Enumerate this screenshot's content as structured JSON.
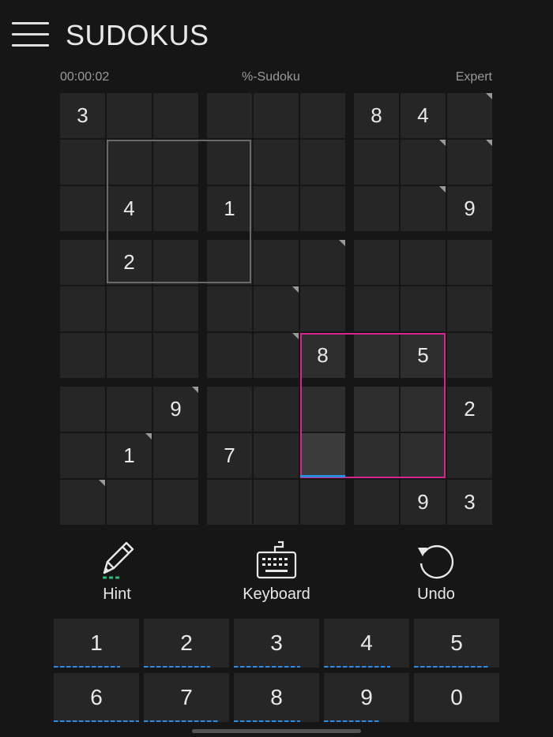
{
  "app": {
    "title": "SUDOKUS"
  },
  "status": {
    "timer": "00:00:02",
    "mode": "%-Sudoku",
    "difficulty": "Expert"
  },
  "board": {
    "grid": [
      [
        "3",
        "",
        "",
        "",
        "",
        "",
        "8",
        "4",
        ""
      ],
      [
        "",
        "",
        "",
        "",
        "",
        "",
        "",
        "",
        ""
      ],
      [
        "",
        "4",
        "",
        "1",
        "",
        "",
        "",
        "",
        "9"
      ],
      [
        "",
        "2",
        "",
        "",
        "",
        "",
        "",
        "",
        ""
      ],
      [
        "",
        "",
        "",
        "",
        "",
        "",
        "",
        "",
        ""
      ],
      [
        "",
        "",
        "",
        "",
        "",
        "8",
        "",
        "5",
        ""
      ],
      [
        "",
        "",
        "9",
        "",
        "",
        "",
        "",
        "",
        "2"
      ],
      [
        "",
        "1",
        "",
        "7",
        "",
        "",
        "",
        "",
        ""
      ],
      [
        "",
        "",
        "",
        "",
        "",
        "",
        "",
        "9",
        "3"
      ]
    ],
    "selected_cell": [
      7,
      5
    ],
    "note_markers": [
      [
        0,
        8
      ],
      [
        1,
        8
      ],
      [
        1,
        7
      ],
      [
        2,
        7
      ],
      [
        3,
        5
      ],
      [
        4,
        4
      ],
      [
        5,
        4
      ],
      [
        6,
        2
      ],
      [
        7,
        1
      ],
      [
        8,
        0
      ]
    ]
  },
  "tools": [
    {
      "name": "hint",
      "label": "Hint",
      "icon": "pencil-icon"
    },
    {
      "name": "keyboard",
      "label": "Keyboard",
      "icon": "keyboard-icon"
    },
    {
      "name": "undo",
      "label": "Undo",
      "icon": "undo-icon"
    }
  ],
  "keypad": {
    "keys": [
      {
        "label": "1",
        "remaining": 0.78
      },
      {
        "label": "2",
        "remaining": 0.78
      },
      {
        "label": "3",
        "remaining": 0.78
      },
      {
        "label": "4",
        "remaining": 0.78
      },
      {
        "label": "5",
        "remaining": 0.89
      },
      {
        "label": "6",
        "remaining": 1.0
      },
      {
        "label": "7",
        "remaining": 0.89
      },
      {
        "label": "8",
        "remaining": 0.78
      },
      {
        "label": "9",
        "remaining": 0.67
      },
      {
        "label": "0",
        "remaining": 0.0
      }
    ]
  },
  "colors": {
    "background": "#161616",
    "cell": "#262626",
    "selected_cell": "#3b3b3b",
    "accent_blue": "#2b8ee0",
    "cage_pink": "#d6258e",
    "cage_gray": "#6a6a6a"
  }
}
